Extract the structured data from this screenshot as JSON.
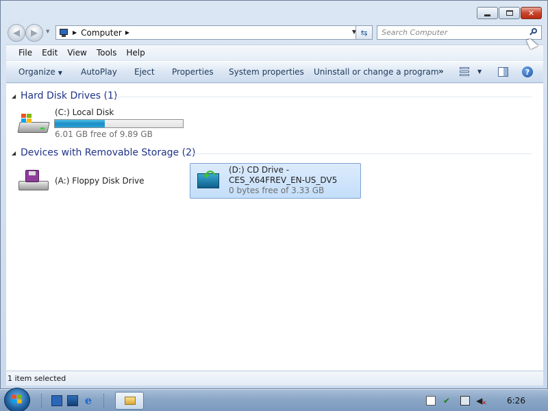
{
  "window": {
    "controls": {
      "minimize": "_",
      "maximize": "□",
      "close": "✕"
    }
  },
  "address": {
    "breadcrumb": "Computer",
    "search_placeholder": "Search Computer"
  },
  "menu": [
    "File",
    "Edit",
    "View",
    "Tools",
    "Help"
  ],
  "toolbar": {
    "organize": "Organize",
    "autoplay": "AutoPlay",
    "eject": "Eject",
    "properties": "Properties",
    "system_properties": "System properties",
    "uninstall": "Uninstall or change a program",
    "more": "»"
  },
  "groups": {
    "hdd": {
      "title": "Hard Disk Drives (1)",
      "drives": [
        {
          "name": "(C:) Local Disk",
          "free": "6.01 GB free of 9.89 GB",
          "used_fraction": 0.39,
          "icon": "hard-drive-icon"
        }
      ]
    },
    "removable": {
      "title": "Devices with Removable Storage (2)",
      "drives": [
        {
          "name": "(A:) Floppy Disk Drive",
          "icon": "floppy-drive-icon"
        },
        {
          "name_line1": "(D:) CD Drive -",
          "name_line2": "CES_X64FREV_EN-US_DV5",
          "free": "0 bytes free of 3.33 GB",
          "icon": "cd-drive-icon",
          "selected": true
        }
      ]
    }
  },
  "status": {
    "text": "1 item selected"
  },
  "taskbar": {
    "clock": "6:26"
  },
  "colors": {
    "group_title": "#1e3287",
    "usage_fill": "#26a0d8",
    "selection": "#c4defa"
  }
}
